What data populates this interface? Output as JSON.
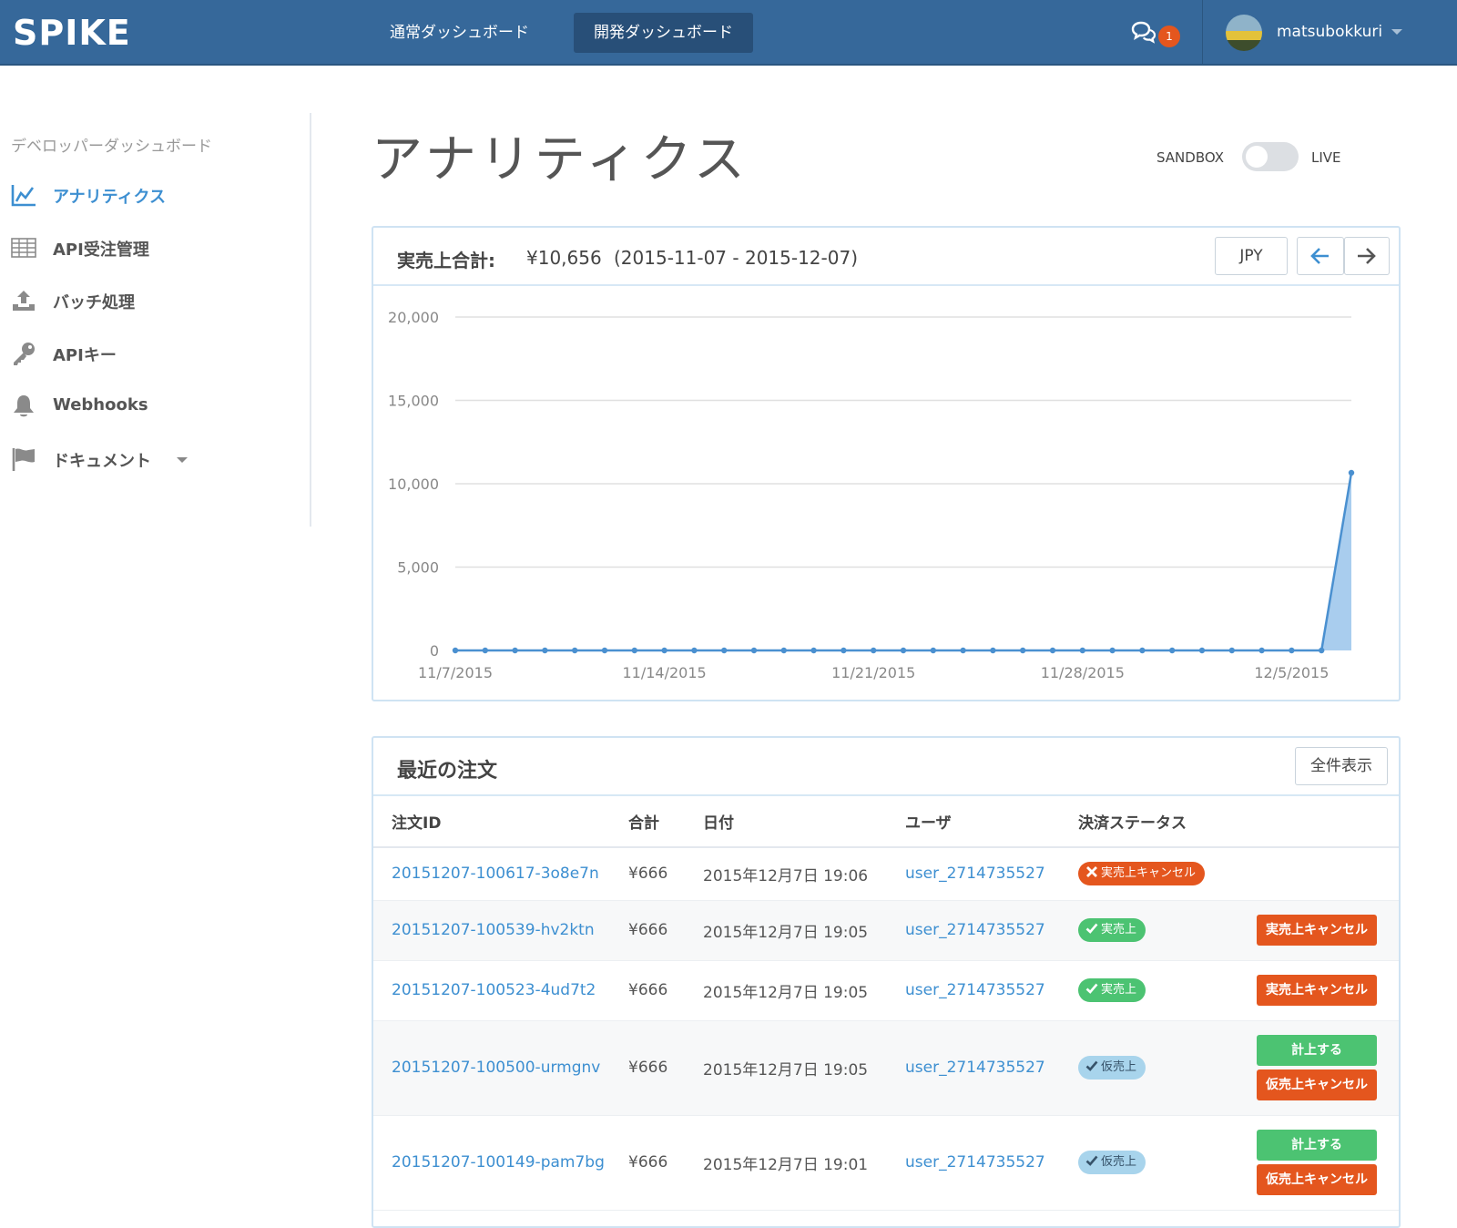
{
  "header": {
    "logo": "SPIKE",
    "tabs": [
      {
        "label": "通常ダッシュボード"
      },
      {
        "label": "開発ダッシュボード"
      }
    ],
    "notification_count": "1",
    "username": "matsubokkuri"
  },
  "sidebar": {
    "heading": "デベロッパーダッシュボード",
    "items": [
      {
        "label": "アナリティクス",
        "icon": "chart-line-icon"
      },
      {
        "label": "API受注管理",
        "icon": "table-grid-icon"
      },
      {
        "label": "バッチ処理",
        "icon": "upload-icon"
      },
      {
        "label": "APIキー",
        "icon": "key-icon"
      },
      {
        "label": "Webhooks",
        "icon": "bell-icon"
      },
      {
        "label": "ドキュメント",
        "icon": "flag-icon"
      }
    ]
  },
  "page": {
    "title": "アナリティクス",
    "toggle_left": "SANDBOX",
    "toggle_right": "LIVE"
  },
  "sales_panel": {
    "title": "実売上合計:",
    "amount": "¥10,656",
    "range": "(2015-11-07 - 2015-12-07)",
    "currency_button": "JPY",
    "prev_icon": "arrow-left-icon",
    "next_icon": "arrow-right-icon"
  },
  "chart_data": {
    "type": "area",
    "x": [
      "2015-11-07",
      "2015-11-08",
      "2015-11-09",
      "2015-11-10",
      "2015-11-11",
      "2015-11-12",
      "2015-11-13",
      "2015-11-14",
      "2015-11-15",
      "2015-11-16",
      "2015-11-17",
      "2015-11-18",
      "2015-11-19",
      "2015-11-20",
      "2015-11-21",
      "2015-11-22",
      "2015-11-23",
      "2015-11-24",
      "2015-11-25",
      "2015-11-26",
      "2015-11-27",
      "2015-11-28",
      "2015-11-29",
      "2015-11-30",
      "2015-12-01",
      "2015-12-02",
      "2015-12-03",
      "2015-12-04",
      "2015-12-05",
      "2015-12-06",
      "2015-12-07"
    ],
    "values": [
      0,
      0,
      0,
      0,
      0,
      0,
      0,
      0,
      0,
      0,
      0,
      0,
      0,
      0,
      0,
      0,
      0,
      0,
      0,
      0,
      0,
      0,
      0,
      0,
      0,
      0,
      0,
      0,
      0,
      0,
      10656
    ],
    "x_tick_labels": [
      "11/7/2015",
      "11/14/2015",
      "11/21/2015",
      "11/28/2015",
      "12/5/2015"
    ],
    "x_tick_index": [
      0,
      7,
      14,
      21,
      28
    ],
    "y_ticks": [
      0,
      5000,
      10000,
      15000,
      20000
    ],
    "y_tick_labels": [
      "0",
      "5,000",
      "10,000",
      "15,000",
      "20,000"
    ],
    "ylim": [
      0,
      20000
    ],
    "grid": true,
    "color": "#4a90d0",
    "fill": "#a9cdee"
  },
  "orders_panel": {
    "title": "最近の注文",
    "show_all": "全件表示",
    "columns": [
      "注文ID",
      "合計",
      "日付",
      "ユーザ",
      "決済ステータス"
    ],
    "rows": [
      {
        "id": "20151207-100617-3o8e7n",
        "total": "¥666",
        "date": "2015年12月7日 19:06",
        "user": "user_2714735527",
        "status": "実売上キャンセル",
        "status_color": "red",
        "status_icon": "x-icon",
        "actions": []
      },
      {
        "id": "20151207-100539-hv2ktn",
        "total": "¥666",
        "date": "2015年12月7日 19:05",
        "user": "user_2714735527",
        "status": "実売上",
        "status_color": "green",
        "status_icon": "check-icon",
        "actions": [
          {
            "label": "実売上キャンセル",
            "color": "red"
          }
        ]
      },
      {
        "id": "20151207-100523-4ud7t2",
        "total": "¥666",
        "date": "2015年12月7日 19:05",
        "user": "user_2714735527",
        "status": "実売上",
        "status_color": "green",
        "status_icon": "check-icon",
        "actions": [
          {
            "label": "実売上キャンセル",
            "color": "red"
          }
        ]
      },
      {
        "id": "20151207-100500-urmgnv",
        "total": "¥666",
        "date": "2015年12月7日 19:05",
        "user": "user_2714735527",
        "status": "仮売上",
        "status_color": "blue",
        "status_icon": "check-icon",
        "actions": [
          {
            "label": "計上する",
            "color": "green"
          },
          {
            "label": "仮売上キャンセル",
            "color": "red"
          }
        ]
      },
      {
        "id": "20151207-100149-pam7bg",
        "total": "¥666",
        "date": "2015年12月7日 19:01",
        "user": "user_2714735527",
        "status": "仮売上",
        "status_color": "blue",
        "status_icon": "check-icon",
        "actions": [
          {
            "label": "計上する",
            "color": "green"
          },
          {
            "label": "仮売上キャンセル",
            "color": "red"
          }
        ]
      }
    ]
  }
}
